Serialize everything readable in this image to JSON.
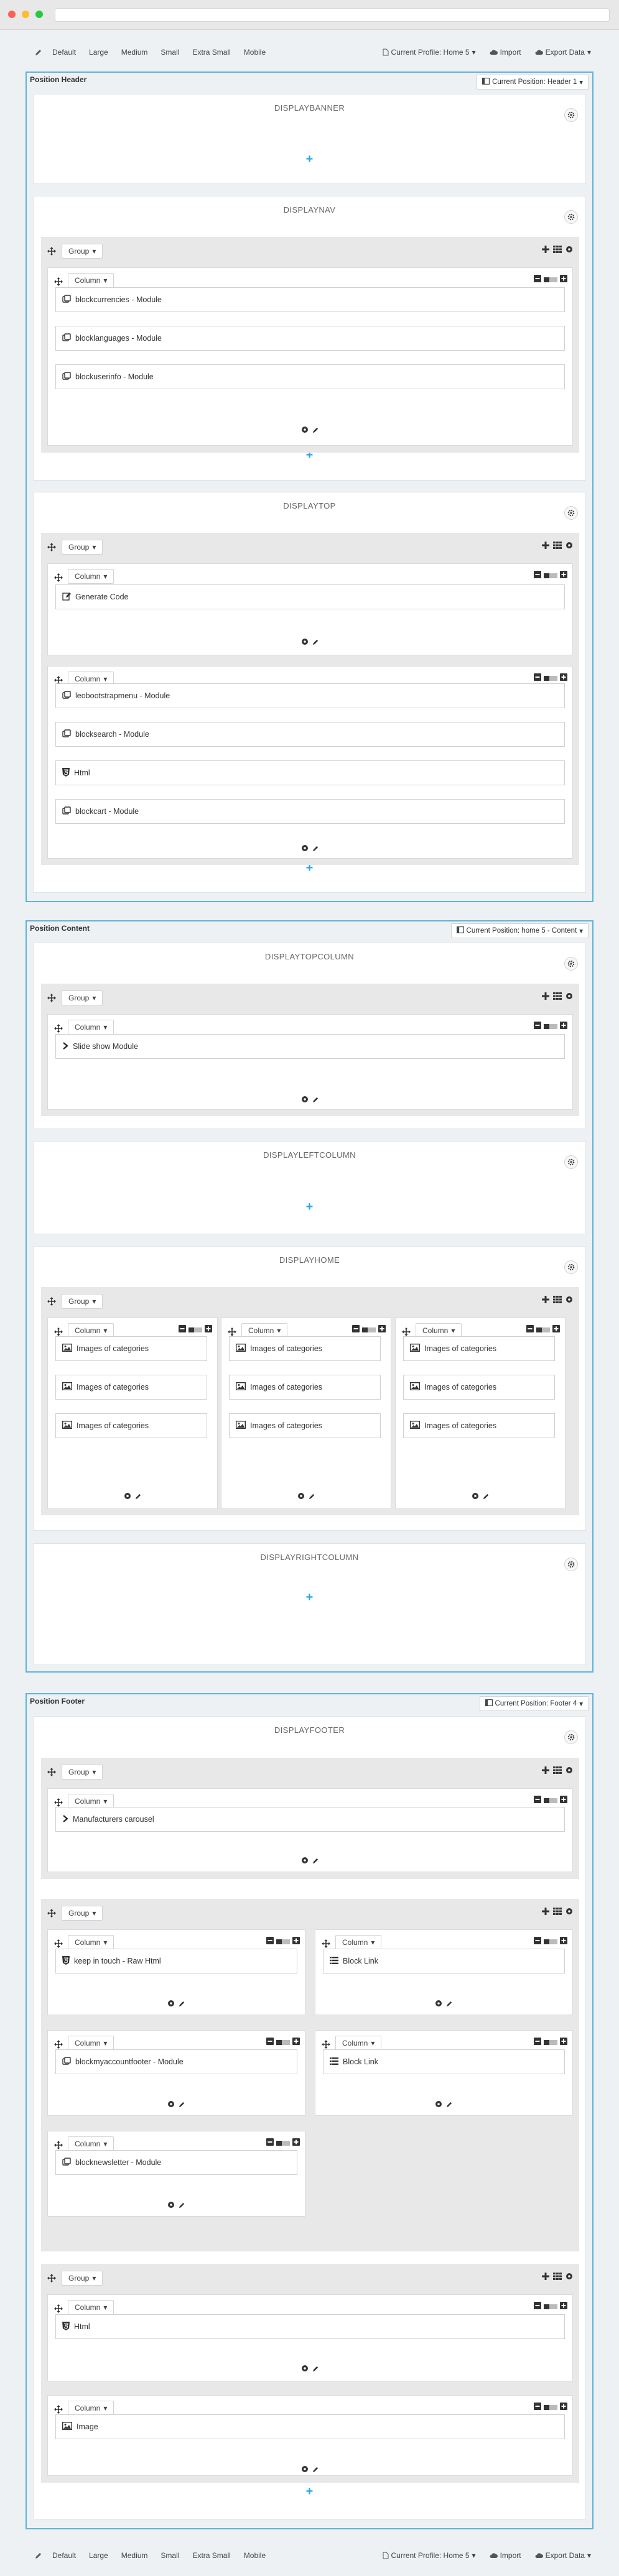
{
  "toolbar": {
    "devices": [
      "Default",
      "Large",
      "Medium",
      "Small",
      "Extra Small",
      "Mobile"
    ],
    "profile": "Current Profile: Home 5",
    "import": "Import",
    "export": "Export Data"
  },
  "bottom_toolbar": {
    "devices": [
      "Default",
      "Large",
      "Medium",
      "Small",
      "Extra Small",
      "Mobile"
    ],
    "profile": "Current Profile: Home 5",
    "import": "Import",
    "export": "Export Data"
  },
  "sections": {
    "header": {
      "title": "Position Header",
      "current": "Current Position: Header 1"
    },
    "content": {
      "title": "Position Content",
      "current": "Current Position: home 5 - Content"
    },
    "footer": {
      "title": "Position Footer",
      "current": "Current Position: Footer 4"
    }
  },
  "labels": {
    "group": "Group",
    "column": "Column"
  },
  "hooks": {
    "displaybanner": "DISPLAYBANNER",
    "displaynav": "DISPLAYNAV",
    "displaytop": "DISPLAYTOP",
    "displaytopcolumn": "DISPLAYTOPCOLUMN",
    "displayleftcolumn": "DISPLAYLEFTCOLUMN",
    "displayhome": "DISPLAYHOME",
    "displayrightcolumn": "DISPLAYRIGHTCOLUMN",
    "displayfooter": "DISPLAYFOOTER"
  },
  "modules": {
    "nav": [
      "blockcurrencies - Module",
      "blocklanguages - Module",
      "blockuserinfo - Module"
    ],
    "top1": [
      "Generate Code"
    ],
    "top2": [
      "leobootstrapmenu - Module",
      "blocksearch - Module",
      "Html",
      "blockcart - Module"
    ],
    "topcolumn": [
      "Slide show Module"
    ],
    "home": "Images of categories",
    "footer_carousel": "Manufacturers carousel",
    "footer_g2": [
      "keep in touch - Raw Html",
      "Block Link",
      "blockmyaccountfooter - Module",
      "Block Link",
      "blocknewsletter - Module"
    ],
    "footer_html": "Html",
    "footer_image": "Image"
  },
  "colors": {
    "accent": "#29a5e0",
    "section_border": "#5fb3d8"
  }
}
